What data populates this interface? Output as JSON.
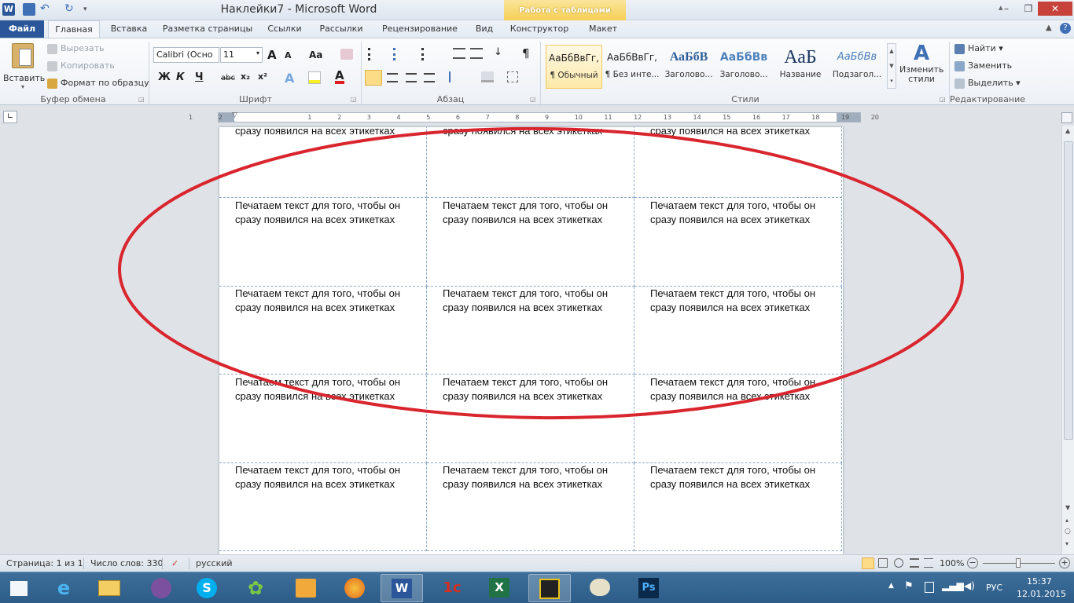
{
  "window": {
    "title": "Наклейки7  -  Microsoft Word",
    "contextual_tab": "Работа с таблицами",
    "controls": [
      "minimize",
      "restore",
      "close"
    ]
  },
  "tabs": [
    "Файл",
    "Главная",
    "Вставка",
    "Разметка страницы",
    "Ссылки",
    "Рассылки",
    "Рецензирование",
    "Вид",
    "Конструктор",
    "Макет"
  ],
  "ribbon": {
    "clipboard": {
      "paste": "Вставить",
      "cut": "Вырезать",
      "copy": "Копировать",
      "format_painter": "Формат по образцу",
      "label": "Буфер обмена"
    },
    "font": {
      "family": "Calibri (Осно",
      "size": "11",
      "grow": "A",
      "shrink": "A",
      "case": "Аа",
      "bold": "Ж",
      "italic": "К",
      "underline": "Ч",
      "strike": "abc",
      "subscript": "x₂",
      "superscript": "x²",
      "label": "Шрифт"
    },
    "paragraph": {
      "label": "Абзац",
      "pilcrow": "¶"
    },
    "styles": {
      "items": [
        {
          "sample": "АаБбВвГг,",
          "name": "¶ Обычный"
        },
        {
          "sample": "АаБбВвГг,",
          "name": "¶ Без инте..."
        },
        {
          "sample": "АаБбВ",
          "name": "Заголово..."
        },
        {
          "sample": "АаБбВв",
          "name": "Заголово..."
        },
        {
          "sample": "АаБ",
          "name": "Название"
        },
        {
          "sample": "АаБбВв",
          "name": "Подзагол..."
        }
      ],
      "change": "Изменить стили",
      "label": "Стили"
    },
    "editing": {
      "find": "Найти",
      "replace": "Заменить",
      "select": "Выделить",
      "label": "Редактирование"
    }
  },
  "ruler": {
    "ticks": [
      "1",
      "2",
      "1",
      "2",
      "3",
      "4",
      "5",
      "6",
      "7",
      "8",
      "9",
      "10",
      "11",
      "12",
      "13",
      "14",
      "15",
      "16",
      "17",
      "18",
      "19",
      "20"
    ]
  },
  "document": {
    "cell_text_line1": "Печатаем текст для того, чтобы он",
    "cell_text_line2": "сразу появился на всех этикетках",
    "rows": 5,
    "cols": 3
  },
  "annotation": {
    "shape": "ellipse",
    "color": "#d9262e"
  },
  "statusbar": {
    "page": "Страница: 1 из 1",
    "words": "Число слов: 330",
    "language": "русский",
    "zoom": "100%"
  },
  "taskbar": {
    "language": "РУС",
    "time": "15:37",
    "date": "12.01.2015"
  },
  "colors": {
    "file_tab": "#2b579a",
    "taskbar": "#2d5c88",
    "accent_red": "#d9262e"
  }
}
